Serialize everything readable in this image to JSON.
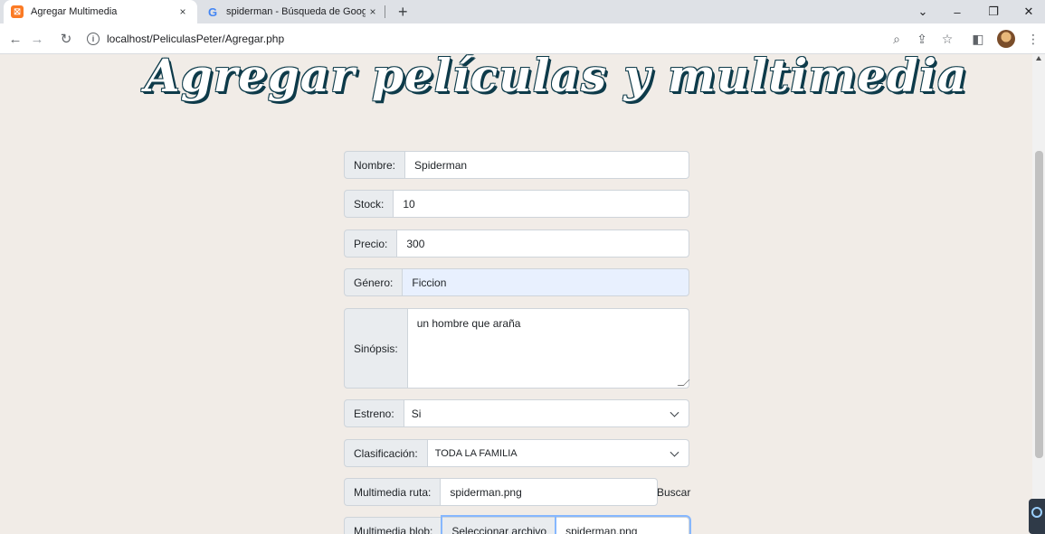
{
  "browser": {
    "tabs": [
      {
        "title": "Agregar Multimedia",
        "close": "×"
      },
      {
        "title": "spiderman - Búsqueda de Google",
        "close": "×"
      }
    ],
    "new_tab": "+",
    "url": "localhost/PeliculasPeter/Agregar.php",
    "favicon_xampp": "⛝",
    "favicon_google": "G"
  },
  "page": {
    "heading": "Agregar películas y multimedia",
    "form": {
      "nombre_label": "Nombre:",
      "nombre_value": "Spiderman",
      "stock_label": "Stock:",
      "stock_value": "10",
      "precio_label": "Precio:",
      "precio_value": "300",
      "genero_label": "Género:",
      "genero_value": "Ficcion",
      "sinopsis_label": "Sinópsis:",
      "sinopsis_value": "un hombre que araña",
      "estreno_label": "Estreno:",
      "estreno_value": "Si",
      "clasificacion_label": "Clasificación:",
      "clasificacion_value": "TODA LA FAMILIA",
      "ruta_label": "Multimedia ruta:",
      "ruta_value": "spiderman.png",
      "buscar_label": "Buscar",
      "blob_label": "Multimedia blob:",
      "blob_button": "Seleccionar archivo",
      "blob_value": "spiderman.png"
    }
  },
  "colors": {
    "page_bg": "#f1ece7",
    "heading_shadow": "#0e3b4a",
    "autofill_bg": "#e8f0fe"
  }
}
